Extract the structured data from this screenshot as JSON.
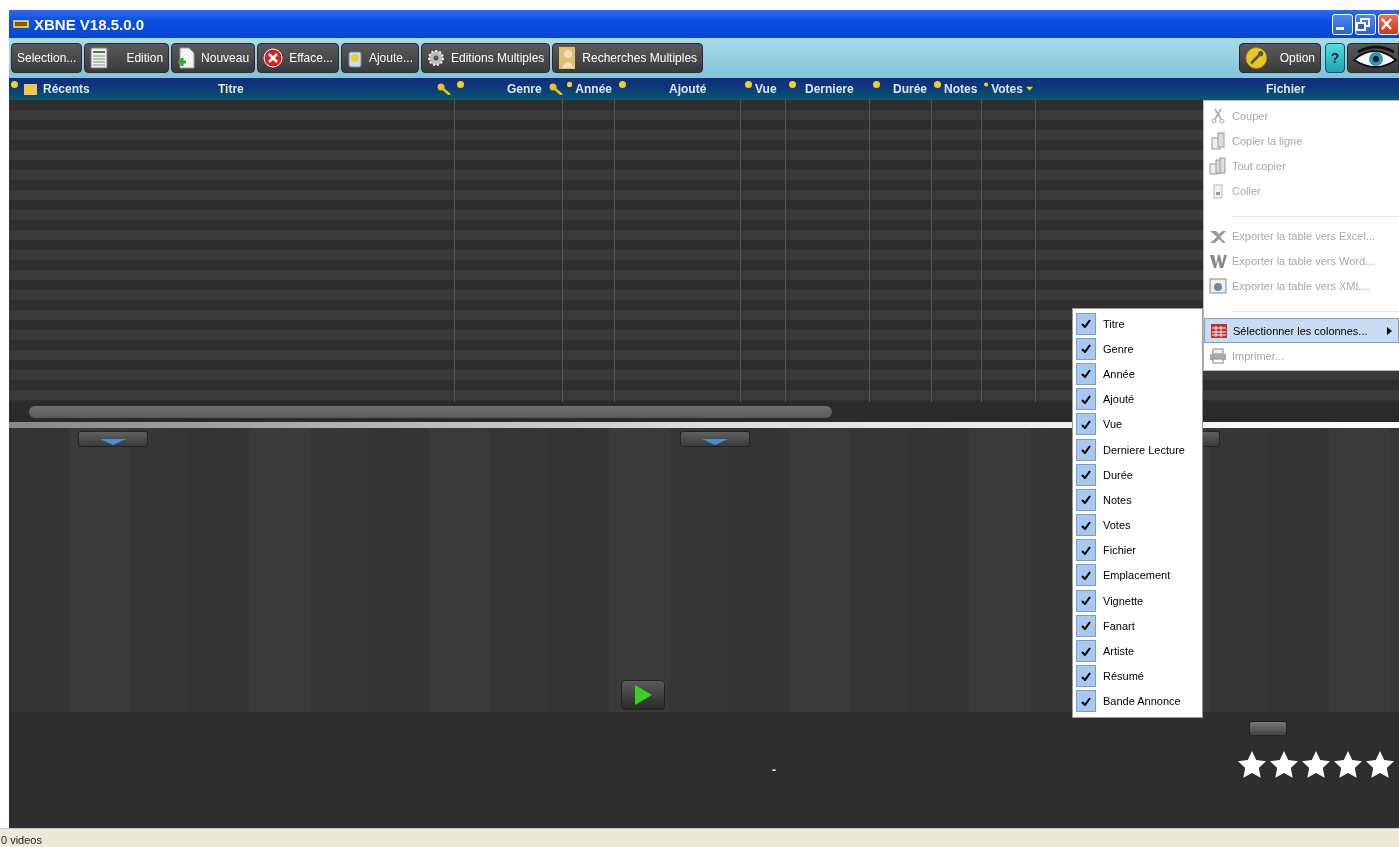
{
  "window": {
    "title": "XBNE V18.5.0.0",
    "controls": [
      {
        "kind": "minimize"
      },
      {
        "kind": "restore"
      },
      {
        "kind": "close"
      }
    ]
  },
  "toolbar": {
    "left": [
      {
        "label": "Selection...",
        "kind": "text"
      },
      {
        "label": "Edition",
        "kind": "sheet"
      },
      {
        "label": "Nouveau",
        "kind": "new"
      },
      {
        "label": "Efface...",
        "kind": "delete"
      },
      {
        "label": "Ajoute...",
        "kind": "add"
      },
      {
        "label": "Editions Multiples",
        "kind": "gears"
      },
      {
        "label": "Recherches Multiples",
        "kind": "figure"
      }
    ],
    "right": [
      {
        "label": "Option",
        "kind": "wrench"
      },
      {
        "label": "?",
        "kind": "help"
      },
      {
        "kind": "eye"
      }
    ]
  },
  "header": {
    "recents": "Récents",
    "columns": [
      {
        "label": "Titre",
        "dot": false,
        "key": true,
        "sorted": false
      },
      {
        "label": "Genre",
        "dot": true,
        "key": true,
        "sorted": false
      },
      {
        "label": "Année",
        "dot": true,
        "key": false,
        "sorted": false
      },
      {
        "label": "Ajouté",
        "dot": true,
        "key": false,
        "sorted": false
      },
      {
        "label": "Vue",
        "dot": true,
        "key": false,
        "sorted": false
      },
      {
        "label": "Derniere",
        "dot": true,
        "key": false,
        "sorted": false
      },
      {
        "label": "Durée",
        "dot": true,
        "key": false,
        "sorted": false
      },
      {
        "label": "Notes",
        "dot": true,
        "key": false,
        "sorted": false
      },
      {
        "label": "Votes",
        "dot": true,
        "key": false,
        "sorted": true
      },
      {
        "label": "Fichier",
        "dot": false,
        "key": false,
        "sorted": false
      }
    ]
  },
  "details": {
    "value": "-",
    "stars": 5
  },
  "context_menu": {
    "items": [
      {
        "kind": "cut",
        "label": "Couper",
        "disabled": true,
        "selected": false,
        "submenu": false
      },
      {
        "kind": "copy",
        "label": "Copier la ligne",
        "disabled": true,
        "selected": false,
        "submenu": false
      },
      {
        "kind": "copyall",
        "label": "Tout copier",
        "disabled": true,
        "selected": false,
        "submenu": false
      },
      {
        "kind": "paste",
        "label": "Coller",
        "disabled": true,
        "selected": false,
        "submenu": false
      },
      {
        "kind": "separator"
      },
      {
        "kind": "excel",
        "label": "Exporter la table vers Excel...",
        "disabled": true,
        "selected": false,
        "submenu": false
      },
      {
        "kind": "word",
        "label": "Exporter la table vers Word...",
        "disabled": true,
        "selected": false,
        "submenu": false
      },
      {
        "kind": "xml",
        "label": "Exporter la table vers XML...",
        "disabled": true,
        "selected": false,
        "submenu": false
      },
      {
        "kind": "separator"
      },
      {
        "kind": "columns",
        "label": "Sélectionner les colonnes...",
        "disabled": false,
        "selected": true,
        "submenu": true
      },
      {
        "kind": "print",
        "label": "Imprimer...",
        "disabled": true,
        "selected": false,
        "submenu": false
      }
    ]
  },
  "column_menu": {
    "items": [
      {
        "label": "Titre",
        "checked": true
      },
      {
        "label": "Genre",
        "checked": true
      },
      {
        "label": "Année",
        "checked": true
      },
      {
        "label": "Ajouté",
        "checked": true
      },
      {
        "label": "Vue",
        "checked": true
      },
      {
        "label": "Derniere Lecture",
        "checked": true
      },
      {
        "label": "Durée",
        "checked": true
      },
      {
        "label": "Notes",
        "checked": true
      },
      {
        "label": "Votes",
        "checked": true
      },
      {
        "label": "Fichier",
        "checked": true
      },
      {
        "label": "Emplacement",
        "checked": true
      },
      {
        "label": "Vignette",
        "checked": true
      },
      {
        "label": "Fanart",
        "checked": true
      },
      {
        "label": "Artiste",
        "checked": true
      },
      {
        "label": "Résumé",
        "checked": true
      },
      {
        "label": "Bande Annonce",
        "checked": true
      }
    ]
  },
  "status_bar": {
    "text": "0 videos"
  }
}
